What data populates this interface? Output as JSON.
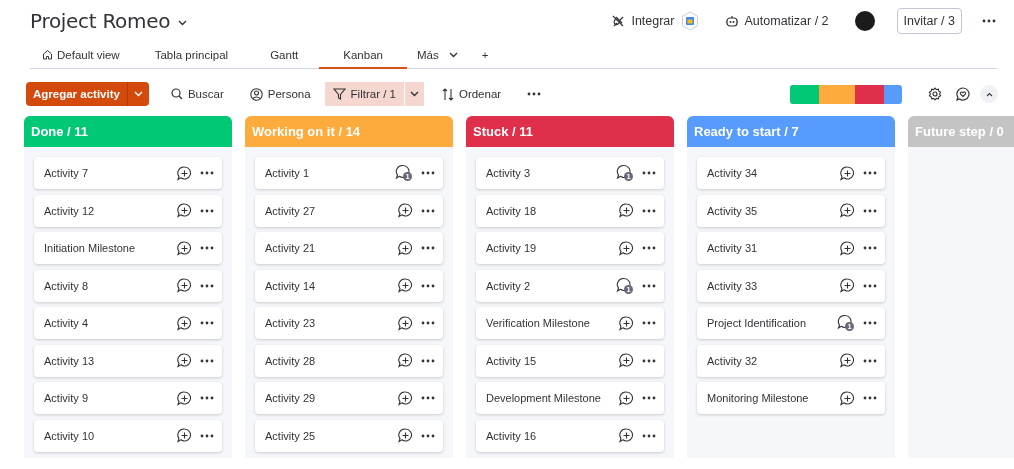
{
  "board": {
    "title": "Project Romeo"
  },
  "header_actions": {
    "integrate": "Integrar",
    "automate": "Automatizar / 2",
    "invite": "Invitar / 3"
  },
  "tabs": [
    {
      "label": "Default view",
      "kind": "home",
      "selected": false
    },
    {
      "label": "Tabla principal",
      "kind": "plain",
      "selected": false
    },
    {
      "label": "Gantt",
      "kind": "plain",
      "selected": false
    },
    {
      "label": "Kanban",
      "kind": "plain",
      "selected": true
    },
    {
      "label": "Más",
      "kind": "more",
      "selected": false
    },
    {
      "label": "+",
      "kind": "add",
      "selected": false
    }
  ],
  "toolbar": {
    "add_button": "Agregar activity",
    "search": "Buscar",
    "person": "Persona",
    "filter": "Filtrar / 1",
    "filter_active": true,
    "sort": "Ordenar"
  },
  "columns": [
    {
      "title": "Done / 11",
      "color": "#00c875",
      "items": [
        {
          "name": "Activity 7"
        },
        {
          "name": "Activity 12"
        },
        {
          "name": "Initiation Milestone"
        },
        {
          "name": "Activity 8"
        },
        {
          "name": "Activity 4"
        },
        {
          "name": "Activity 13"
        },
        {
          "name": "Activity 9"
        },
        {
          "name": "Activity 10"
        }
      ]
    },
    {
      "title": "Working on it / 14",
      "color": "#fdab3d",
      "items": [
        {
          "name": "Activity 1",
          "updates": "1"
        },
        {
          "name": "Activity 27"
        },
        {
          "name": "Activity 21"
        },
        {
          "name": "Activity 14"
        },
        {
          "name": "Activity 23"
        },
        {
          "name": "Activity 28"
        },
        {
          "name": "Activity 29"
        },
        {
          "name": "Activity 25"
        }
      ]
    },
    {
      "title": "Stuck / 11",
      "color": "#df2f4a",
      "items": [
        {
          "name": "Activity 3",
          "updates": "1"
        },
        {
          "name": "Activity 18"
        },
        {
          "name": "Activity 19"
        },
        {
          "name": "Activity 2",
          "updates": "1"
        },
        {
          "name": "Verification Milestone"
        },
        {
          "name": "Activity 15"
        },
        {
          "name": "Development Milestone"
        },
        {
          "name": "Activity 16"
        }
      ]
    },
    {
      "title": "Ready to start / 7",
      "color": "#579bfc",
      "items": [
        {
          "name": "Activity 34"
        },
        {
          "name": "Activity 35"
        },
        {
          "name": "Activity 31"
        },
        {
          "name": "Activity 33"
        },
        {
          "name": "Project Identification",
          "updates": "1"
        },
        {
          "name": "Activity 32"
        },
        {
          "name": "Monitoring Milestone"
        }
      ]
    },
    {
      "title": "Future step / 0",
      "color": "#c4c4c4"
    }
  ]
}
